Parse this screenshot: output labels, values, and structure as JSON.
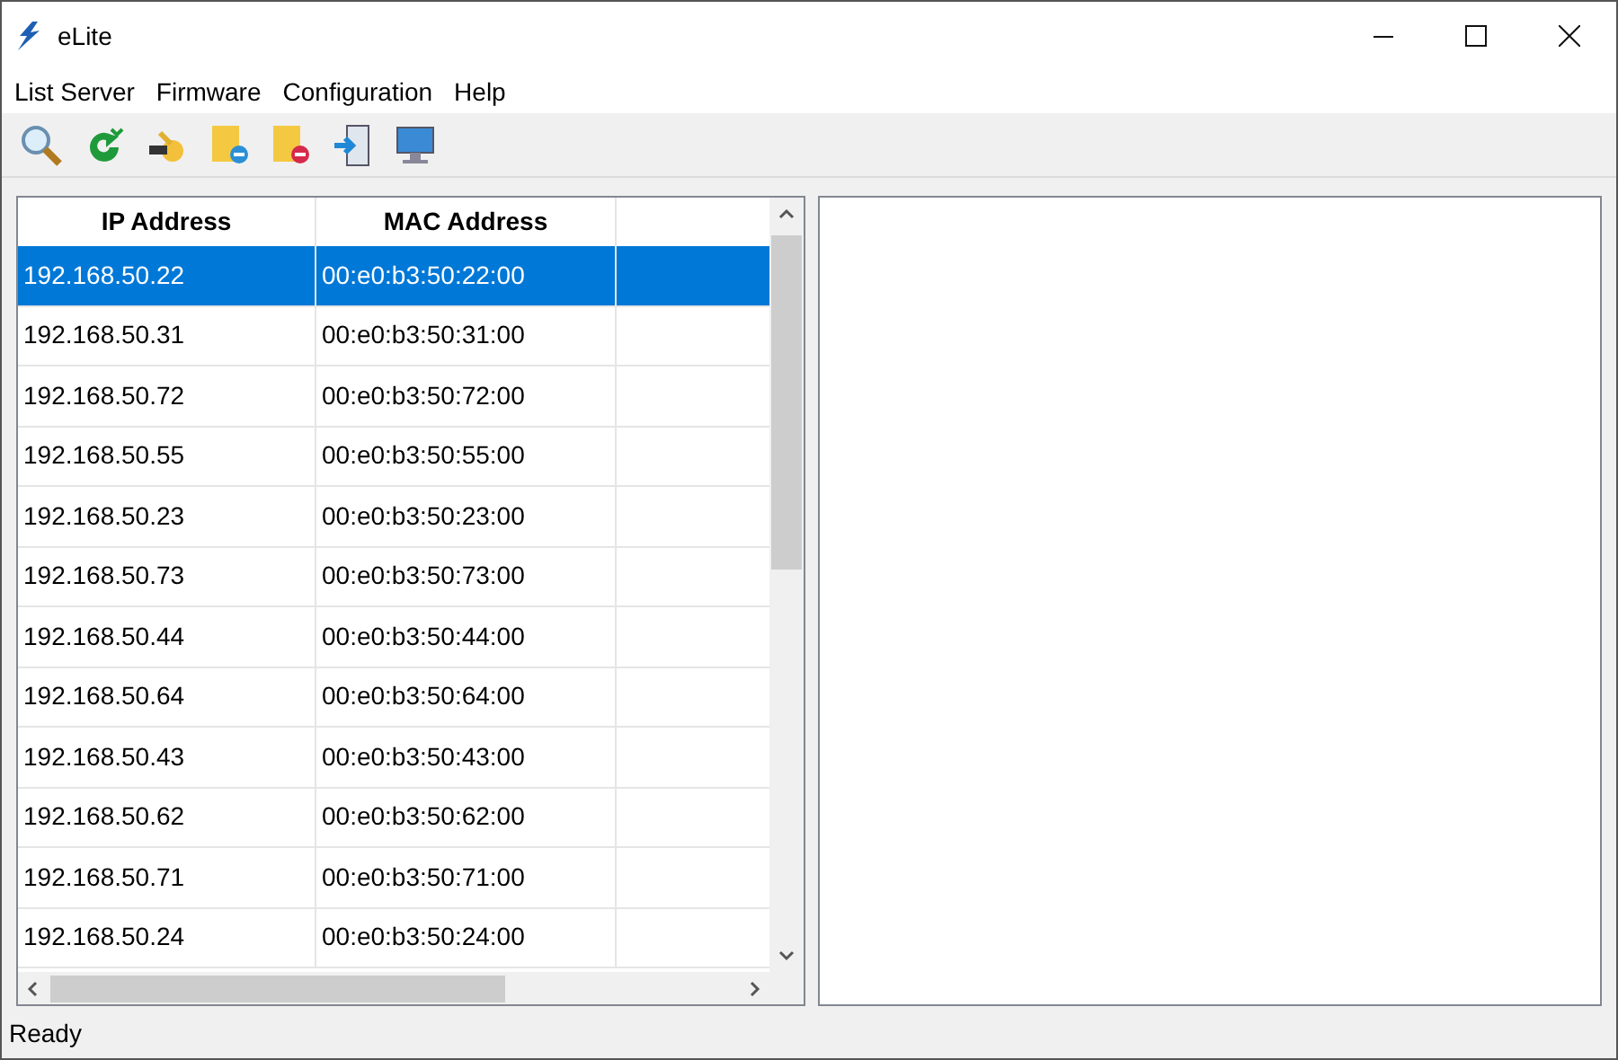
{
  "window": {
    "title": "eLite"
  },
  "menu": [
    "List Server",
    "Firmware",
    "Configuration",
    "Help"
  ],
  "table": {
    "columns": [
      "IP Address",
      "MAC Address"
    ],
    "rows": [
      {
        "ip": "192.168.50.22",
        "mac": "00:e0:b3:50:22:00",
        "selected": true
      },
      {
        "ip": "192.168.50.31",
        "mac": "00:e0:b3:50:31:00",
        "selected": false
      },
      {
        "ip": "192.168.50.72",
        "mac": "00:e0:b3:50:72:00",
        "selected": false
      },
      {
        "ip": "192.168.50.55",
        "mac": "00:e0:b3:50:55:00",
        "selected": false
      },
      {
        "ip": "192.168.50.23",
        "mac": "00:e0:b3:50:23:00",
        "selected": false
      },
      {
        "ip": "192.168.50.73",
        "mac": "00:e0:b3:50:73:00",
        "selected": false
      },
      {
        "ip": "192.168.50.44",
        "mac": "00:e0:b3:50:44:00",
        "selected": false
      },
      {
        "ip": "192.168.50.64",
        "mac": "00:e0:b3:50:64:00",
        "selected": false
      },
      {
        "ip": "192.168.50.43",
        "mac": "00:e0:b3:50:43:00",
        "selected": false
      },
      {
        "ip": "192.168.50.62",
        "mac": "00:e0:b3:50:62:00",
        "selected": false
      },
      {
        "ip": "192.168.50.71",
        "mac": "00:e0:b3:50:71:00",
        "selected": false
      },
      {
        "ip": "192.168.50.24",
        "mac": "00:e0:b3:50:24:00",
        "selected": false
      }
    ]
  },
  "status_bar": "Ready"
}
